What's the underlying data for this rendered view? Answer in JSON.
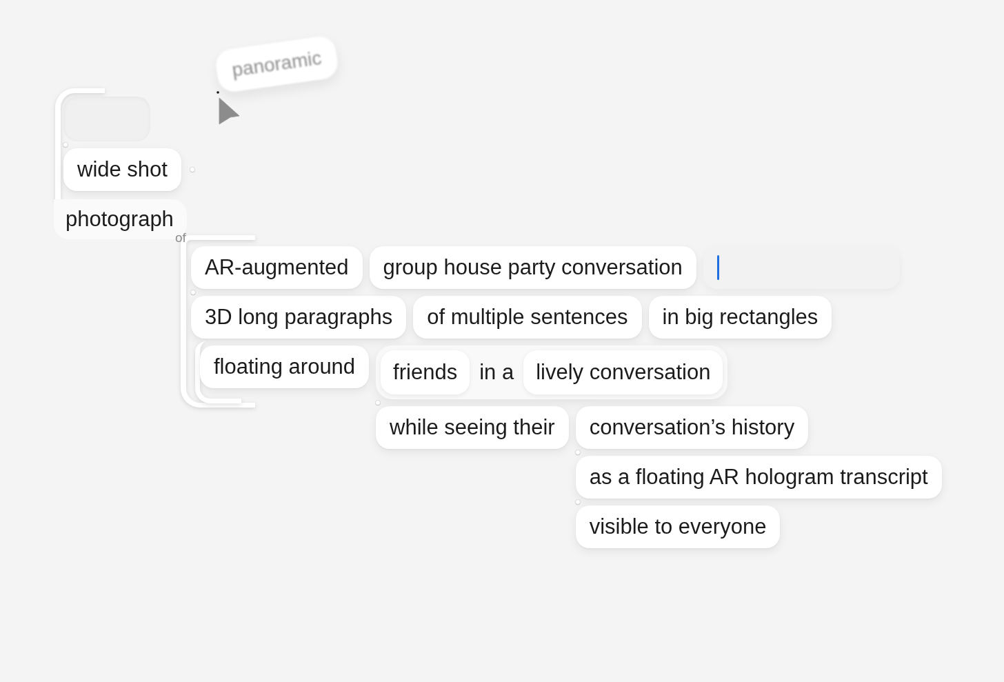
{
  "dragged_chip": {
    "label": "panoramic",
    "dragging": true
  },
  "phrase_tree": {
    "kind": "group",
    "children": [
      {
        "kind": "slot"
      },
      {
        "kind": "chip",
        "label": "wide shot"
      },
      {
        "kind": "head",
        "label": "photograph",
        "link": "of",
        "children": [
          {
            "kind": "group",
            "children": [
              {
                "kind": "chip",
                "label": "AR-augmented",
                "children": [
                  {
                    "kind": "chip",
                    "label": "group house party conversation",
                    "children": [
                      {
                        "kind": "input",
                        "focused": true
                      }
                    ]
                  }
                ]
              },
              {
                "kind": "chip",
                "label": "3D long paragraphs",
                "children": [
                  {
                    "kind": "chip",
                    "label": "of multiple sentences",
                    "children": [
                      {
                        "kind": "chip",
                        "label": "in big rectangles"
                      }
                    ]
                  }
                ]
              },
              {
                "kind": "group",
                "children": [
                  {
                    "kind": "chip",
                    "label": "floating around",
                    "children": [
                      {
                        "kind": "phrase",
                        "parts": [
                          {
                            "kind": "chip",
                            "label": "friends"
                          },
                          {
                            "kind": "text",
                            "label": "in a"
                          },
                          {
                            "kind": "chip",
                            "label": "lively conversation"
                          }
                        ]
                      },
                      {
                        "kind": "chip",
                        "label": "while seeing their",
                        "children": [
                          {
                            "kind": "chip",
                            "label": "conversation’s history"
                          },
                          {
                            "kind": "chip",
                            "label": "as a floating AR hologram transcript"
                          },
                          {
                            "kind": "chip",
                            "label": "visible to everyone"
                          }
                        ]
                      }
                    ]
                  }
                ]
              }
            ]
          }
        ]
      }
    ]
  }
}
